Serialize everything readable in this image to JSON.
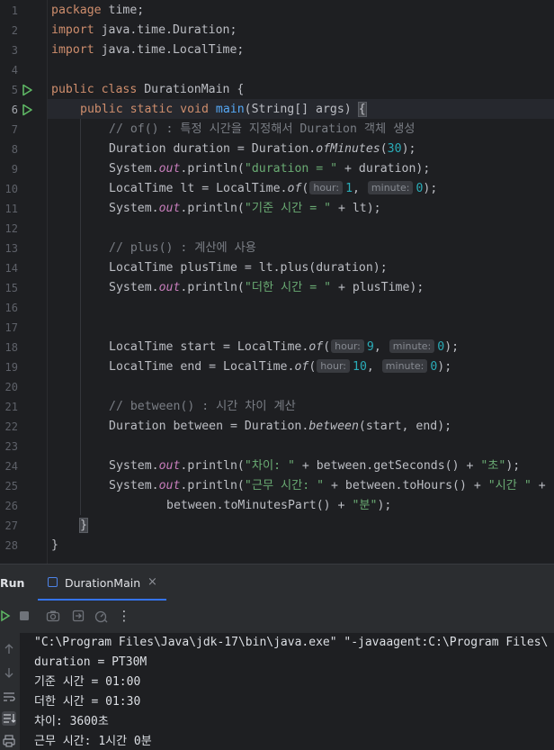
{
  "editor": {
    "line_numbers": [
      "1",
      "2",
      "3",
      "4",
      "5",
      "6",
      "7",
      "8",
      "9",
      "10",
      "11",
      "12",
      "13",
      "14",
      "15",
      "16",
      "17",
      "18",
      "19",
      "20",
      "21",
      "22",
      "23",
      "24",
      "25",
      "26",
      "27",
      "28"
    ],
    "lines": {
      "l1_kw": "package",
      "l1_rest": " time;",
      "l2_kw": "import",
      "l2_rest": " java.time.Duration;",
      "l3_kw": "import",
      "l3_rest": " java.time.LocalTime;",
      "l5_kw": "public class",
      "l5_rest": " DurationMain {",
      "l6_kw": "public static void",
      "l6_fn": "main",
      "l6_rest": "(String[] args) ",
      "l6_brace": "{",
      "l7_comment": "// of() : 특정 시간을 지정해서 Duration 객체 생성",
      "l8_a": "Duration duration = Duration.",
      "l8_m": "ofMinutes",
      "l8_b": "(",
      "l8_n": "30",
      "l8_c": ");",
      "l9_a": "System.",
      "l9_f": "out",
      "l9_b": ".println(",
      "l9_s": "\"duration = \"",
      "l9_c": " + duration);",
      "l10_a": "LocalTime lt = LocalTime.",
      "l10_m": "of",
      "l10_b": "(",
      "l10_h1": "hour:",
      "l10_n1": "1",
      "l10_comma": ",",
      "l10_h2": "minute:",
      "l10_n2": "0",
      "l10_c": ");",
      "l11_a": "System.",
      "l11_f": "out",
      "l11_b": ".println(",
      "l11_s": "\"기준 시간 = \"",
      "l11_c": " + lt);",
      "l13_comment": "// plus() : 계산에 사용",
      "l14_a": "LocalTime plusTime = lt.plus(duration);",
      "l15_a": "System.",
      "l15_f": "out",
      "l15_b": ".println(",
      "l15_s": "\"더한 시간 = \"",
      "l15_c": " + plusTime);",
      "l18_a": "LocalTime start = LocalTime.",
      "l18_m": "of",
      "l18_b": "(",
      "l18_h1": "hour:",
      "l18_n1": "9",
      "l18_comma": ",",
      "l18_h2": "minute:",
      "l18_n2": "0",
      "l18_c": ");",
      "l19_a": "LocalTime end = LocalTime.",
      "l19_m": "of",
      "l19_b": "(",
      "l19_h1": "hour:",
      "l19_n1": "10",
      "l19_comma": ",",
      "l19_h2": "minute:",
      "l19_n2": "0",
      "l19_c": ");",
      "l21_comment": "// between() : 시간 차이 계산",
      "l22_a": "Duration between = Duration.",
      "l22_m": "between",
      "l22_c": "(start, end);",
      "l24_a": "System.",
      "l24_f": "out",
      "l24_b": ".println(",
      "l24_s1": "\"차이: \"",
      "l24_mid": " + between.getSeconds() + ",
      "l24_s2": "\"초\"",
      "l24_c": ");",
      "l25_a": "System.",
      "l25_f": "out",
      "l25_b": ".println(",
      "l25_s1": "\"근무 시간: \"",
      "l25_mid": " + between.toHours() + ",
      "l25_s2": "\"시간 \"",
      "l25_c": " +",
      "l26_a": "between.toMinutesPart() + ",
      "l26_s": "\"분\"",
      "l26_c": ");",
      "l27": "}",
      "l28": "}"
    }
  },
  "run_panel": {
    "title": "Run",
    "tab_label": "DurationMain",
    "tab_close": "×",
    "toolbar_more": "⋮",
    "console_lines": [
      "\"C:\\Program Files\\Java\\jdk-17\\bin\\java.exe\" \"-javaagent:C:\\Program Files\\",
      "duration = PT30M",
      "기준 시간 = 01:00",
      "더한 시간 = 01:30",
      "차이: 3600초",
      "근무 시간: 1시간 0분"
    ]
  },
  "colors": {
    "background": "#1e1f22",
    "keyword": "#cf8e6d",
    "method": "#56a8f5",
    "string": "#6aab73",
    "number": "#2aacb8",
    "static_field": "#c77dbb",
    "comment": "#7a7e85",
    "run_gutter": "#5fb865",
    "accent": "#3574f0"
  },
  "icons": [
    "run-gutter-icon",
    "stop-icon",
    "camera-icon",
    "restore-layout-icon",
    "profiler-icon",
    "more-options-icon",
    "scroll-up-icon",
    "scroll-down-icon",
    "soft-wrap-icon",
    "scroll-to-end-icon",
    "print-icon",
    "class-file-icon"
  ]
}
